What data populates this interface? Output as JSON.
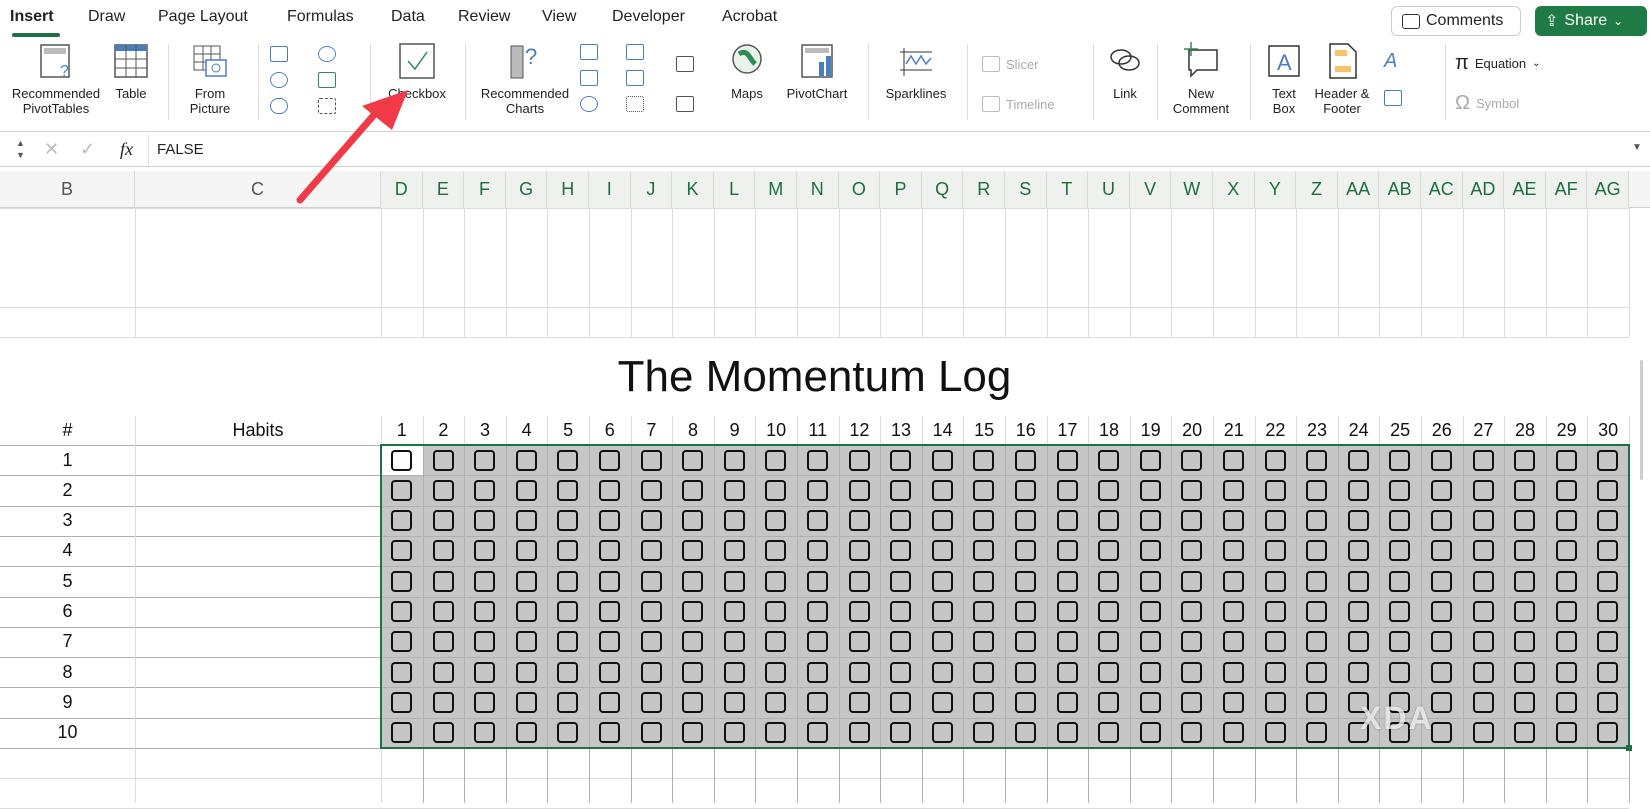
{
  "tabs": [
    "Insert",
    "Draw",
    "Page Layout",
    "Formulas",
    "Data",
    "Review",
    "View",
    "Developer",
    "Acrobat"
  ],
  "active_tab": "Insert",
  "comments_label": "Comments",
  "share_label": "Share",
  "ribbon": {
    "pivot_l1": "Recommended",
    "pivot_l2": "PivotTables",
    "table": "Table",
    "picture_l1": "From",
    "picture_l2": "Picture",
    "checkbox": "Checkbox",
    "charts_l1": "Recommended",
    "charts_l2": "Charts",
    "maps": "Maps",
    "pivotchart": "PivotChart",
    "sparklines": "Sparklines",
    "slicer": "Slicer",
    "timeline": "Timeline",
    "link": "Link",
    "comment_l1": "New",
    "comment_l2": "Comment",
    "textbox_l1": "Text",
    "textbox_l2": "Box",
    "hf_l1": "Header &",
    "hf_l2": "Footer",
    "equation": "Equation",
    "symbol": "Symbol"
  },
  "formula_bar": {
    "fx": "fx",
    "value": "FALSE"
  },
  "columns": [
    "B",
    "C",
    "D",
    "E",
    "F",
    "G",
    "H",
    "I",
    "J",
    "K",
    "L",
    "M",
    "N",
    "O",
    "P",
    "Q",
    "R",
    "S",
    "T",
    "U",
    "V",
    "W",
    "X",
    "Y",
    "Z",
    "AA",
    "AB",
    "AC",
    "AD",
    "AE",
    "AF",
    "AG"
  ],
  "sheet": {
    "title": "The Momentum Log",
    "hash_header": "#",
    "habits_header": "Habits",
    "days": [
      "1",
      "2",
      "3",
      "4",
      "5",
      "6",
      "7",
      "8",
      "9",
      "10",
      "11",
      "12",
      "13",
      "14",
      "15",
      "16",
      "17",
      "18",
      "19",
      "20",
      "21",
      "22",
      "23",
      "24",
      "25",
      "26",
      "27",
      "28",
      "29",
      "30"
    ],
    "rows": [
      "1",
      "2",
      "3",
      "4",
      "5",
      "6",
      "7",
      "8",
      "9",
      "10"
    ],
    "checked_cells": [],
    "active_cell": "D5"
  },
  "colors": {
    "accent": "#1e7145",
    "selection_fill": "#c6c6c6",
    "arrow": "#f03a47"
  },
  "watermark": "XDA"
}
